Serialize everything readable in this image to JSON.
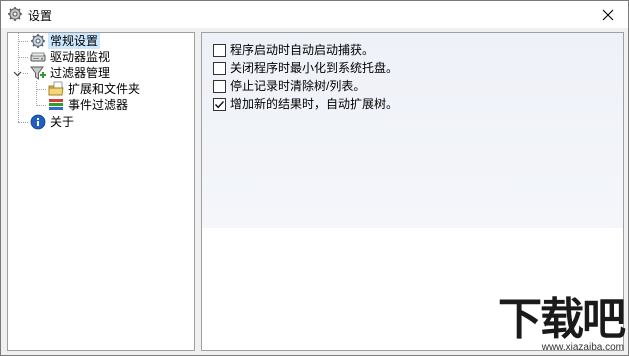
{
  "window": {
    "title": "设置",
    "icon": "gear-icon"
  },
  "tree": {
    "items": [
      {
        "label": "常规设置",
        "icon": "gear-icon",
        "selected": true
      },
      {
        "label": "驱动器监视",
        "icon": "drive-icon"
      },
      {
        "label": "过滤器管理",
        "icon": "funnel-add-icon",
        "expanded": true
      },
      {
        "label": "扩展和文件夹",
        "icon": "folder-doc-icon"
      },
      {
        "label": "事件过滤器",
        "icon": "color-bars-icon"
      },
      {
        "label": "关于",
        "icon": "info-icon"
      }
    ]
  },
  "options": [
    {
      "label": "程序启动时自动启动捕获。",
      "checked": false
    },
    {
      "label": "关闭程序时最小化到系统托盘。",
      "checked": false
    },
    {
      "label": "停止记录时清除树/列表。",
      "checked": false
    },
    {
      "label": "增加新的结果时，自动扩展树。",
      "checked": true
    }
  ],
  "watermark": {
    "brand": "下载吧",
    "url": "www.xiazaiba.com"
  },
  "colors": {
    "selection": "#cce8ff",
    "tree_line": "#a0a0a0",
    "info_blue": "#1f5fbf"
  }
}
